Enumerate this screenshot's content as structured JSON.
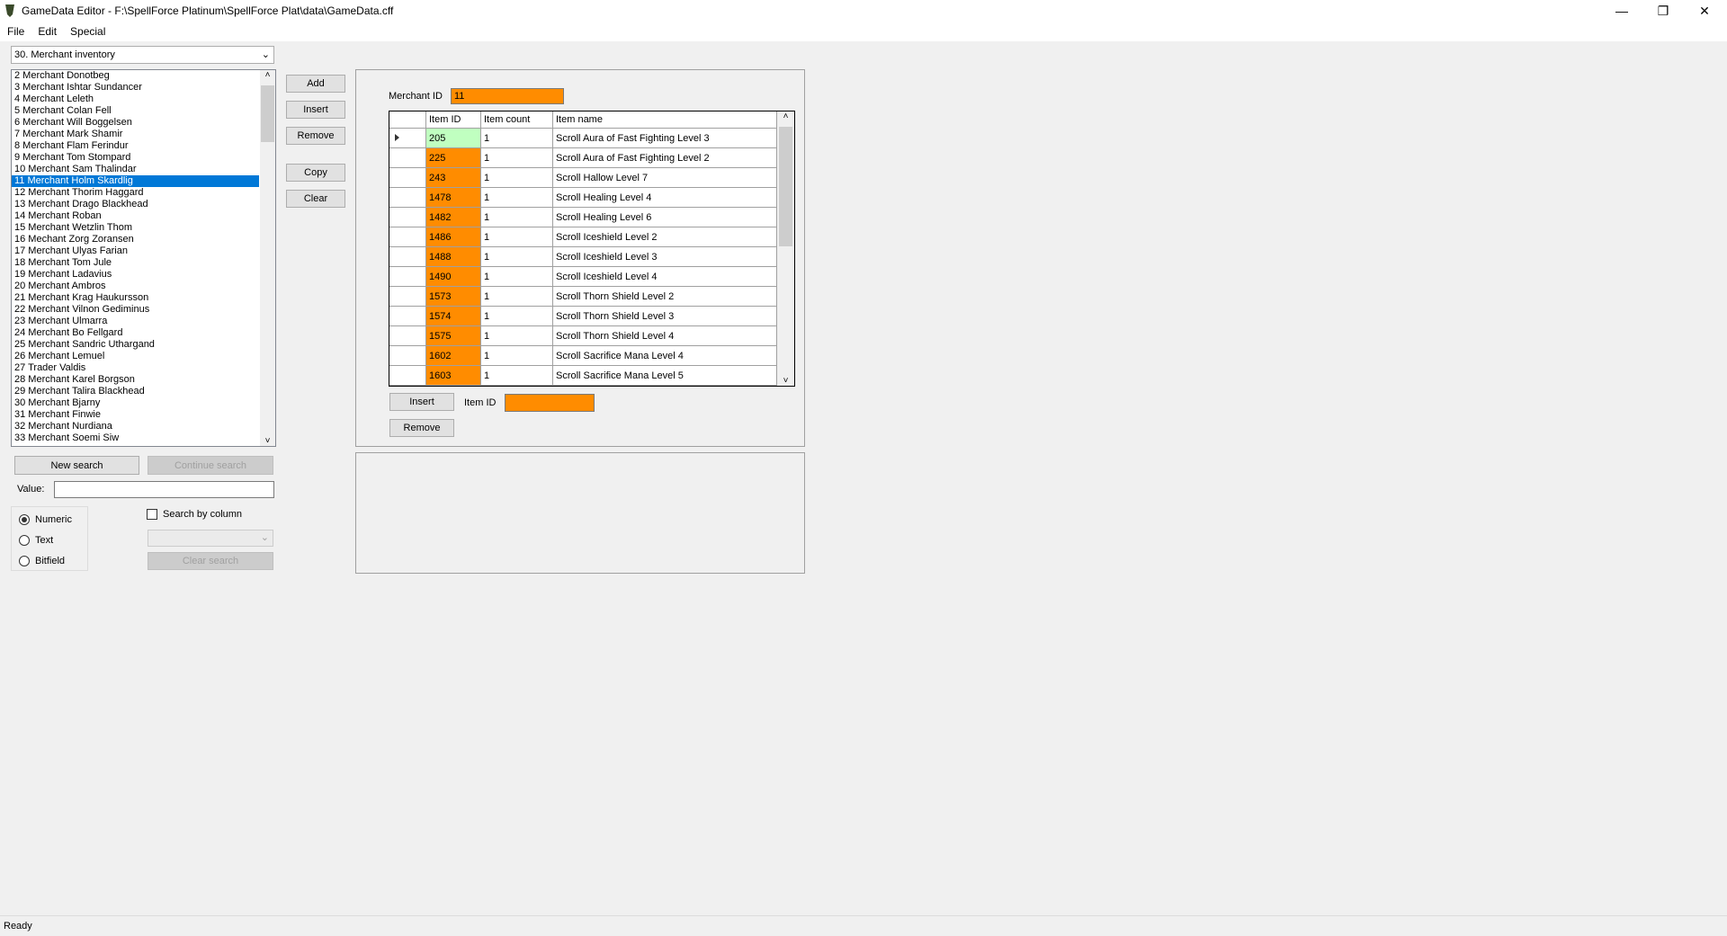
{
  "window": {
    "title": "GameData Editor - F:\\SpellForce Platinum\\SpellForce Plat\\data\\GameData.cff",
    "minimize": "—",
    "maximize": "❐",
    "close": "✕"
  },
  "menu": [
    "File",
    "Edit",
    "Special"
  ],
  "category_select": {
    "value": "30. Merchant inventory"
  },
  "merchant_list": {
    "selected": "11 Merchant Holm Skardlig",
    "items": [
      "2 Merchant Donotbeg",
      "3 Merchant Ishtar Sundancer",
      "4 Merchant Leleth",
      "5 Merchant Colan Fell",
      "6 Merchant Will Boggelsen",
      "7 Merchant Mark Shamir",
      "8 Merchant Flam Ferindur",
      "9 Merchant Tom Stompard",
      "10 Merchant Sam Thalindar",
      "11 Merchant Holm Skardlig",
      "12 Merchant Thorim Haggard",
      "13 Merchant Drago Blackhead",
      "14 Merchant Roban",
      "15 Merchant Wetzlin Thom",
      "16 Mechant Zorg Zoransen",
      "17 Merchant Ulyas Farian",
      "18 Merchant Tom Jule",
      "19 Merchant Ladavius",
      "20 Merchant Ambros",
      "21 Merchant Krag Haukursson",
      "22 Merchant Vilnon Gediminus",
      "23 Merchant Ulmarra",
      "24 Merchant Bo Fellgard",
      "25 Merchant Sandric Uthargand",
      "26 Merchant Lemuel",
      "27 Trader Valdis",
      "28 Merchant Karel Borgson",
      "29 Merchant Talira Blackhead",
      "30 Merchant Bjarny",
      "31 Merchant Finwie",
      "32 Merchant Nurdiana",
      "33 Merchant Soemi Siw"
    ]
  },
  "side_buttons": {
    "add": "Add",
    "insert": "Insert",
    "remove": "Remove",
    "copy": "Copy",
    "clear": "Clear"
  },
  "detail": {
    "merchant_id_label": "Merchant ID",
    "merchant_id": "11",
    "columns": [
      "Item ID",
      "Item count",
      "Item name"
    ],
    "rows": [
      [
        "205",
        "1",
        "Scroll Aura of Fast Fighting Level 3"
      ],
      [
        "225",
        "1",
        "Scroll Aura of Fast Fighting Level 2"
      ],
      [
        "243",
        "1",
        "Scroll Hallow Level 7"
      ],
      [
        "1478",
        "1",
        "Scroll Healing Level 4"
      ],
      [
        "1482",
        "1",
        "Scroll Healing Level 6"
      ],
      [
        "1486",
        "1",
        "Scroll Iceshield Level 2"
      ],
      [
        "1488",
        "1",
        "Scroll Iceshield Level 3"
      ],
      [
        "1490",
        "1",
        "Scroll Iceshield Level 4"
      ],
      [
        "1573",
        "1",
        "Scroll Thorn Shield Level 2"
      ],
      [
        "1574",
        "1",
        "Scroll Thorn Shield Level 3"
      ],
      [
        "1575",
        "1",
        "Scroll Thorn Shield Level 4"
      ],
      [
        "1602",
        "1",
        "Scroll Sacrifice Mana Level 4"
      ],
      [
        "1603",
        "1",
        "Scroll Sacrifice Mana Level 5"
      ]
    ],
    "insert": "Insert",
    "item_id_label": "Item ID",
    "item_id": "",
    "remove": "Remove"
  },
  "search": {
    "new_search": "New search",
    "continue_search": "Continue search",
    "value_label": "Value:",
    "value": "",
    "numeric": "Numeric",
    "text": "Text",
    "bitfield": "Bitfield",
    "search_by_column": "Search by column",
    "clear_search": "Clear search"
  },
  "status": "Ready",
  "colors": {
    "accent": "#0078d7",
    "invalid_id": "#ff8c00",
    "valid_id": "#c0ffc0"
  }
}
